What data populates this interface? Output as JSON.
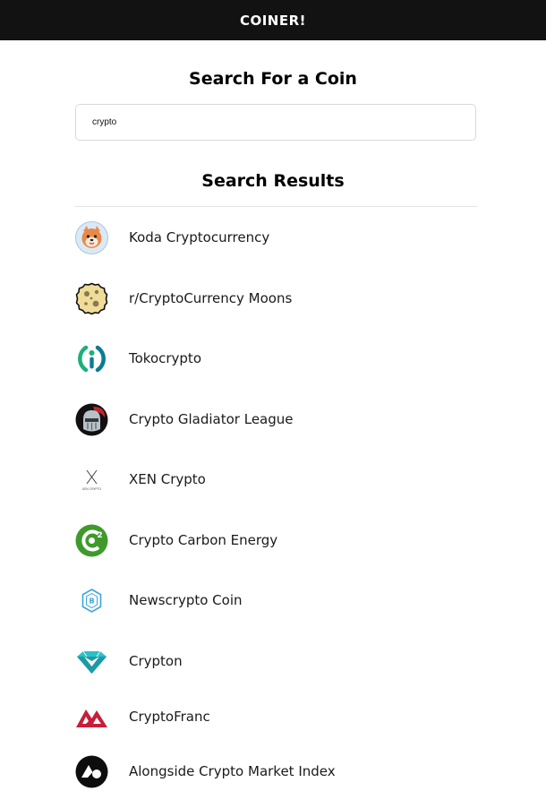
{
  "header": {
    "brand": "COINER!",
    "background": "#121212"
  },
  "search": {
    "title": "Search For a Coin",
    "value": "crypto"
  },
  "results": {
    "title": "Search Results",
    "items": [
      {
        "name": "Koda Cryptocurrency",
        "icon": "koda-dog-icon"
      },
      {
        "name": "r/CryptoCurrency Moons",
        "icon": "moon-icon"
      },
      {
        "name": "Tokocrypto",
        "icon": "tokocrypto-icon"
      },
      {
        "name": "Crypto Gladiator League",
        "icon": "gladiator-helmet-icon"
      },
      {
        "name": "XEN Crypto",
        "icon": "xen-x-icon",
        "icon_text": "XEN CRYPTO"
      },
      {
        "name": "Crypto Carbon Energy",
        "icon": "carbon-energy-c2-icon"
      },
      {
        "name": "Newscrypto Coin",
        "icon": "newscrypto-hexagon-icon"
      },
      {
        "name": "Crypton",
        "icon": "crypton-diamond-icon"
      },
      {
        "name": "CryptoFranc",
        "icon": "cryptofranc-mountain-icon"
      },
      {
        "name": "Alongside Crypto Market Index",
        "icon": "alongside-icon"
      }
    ]
  }
}
